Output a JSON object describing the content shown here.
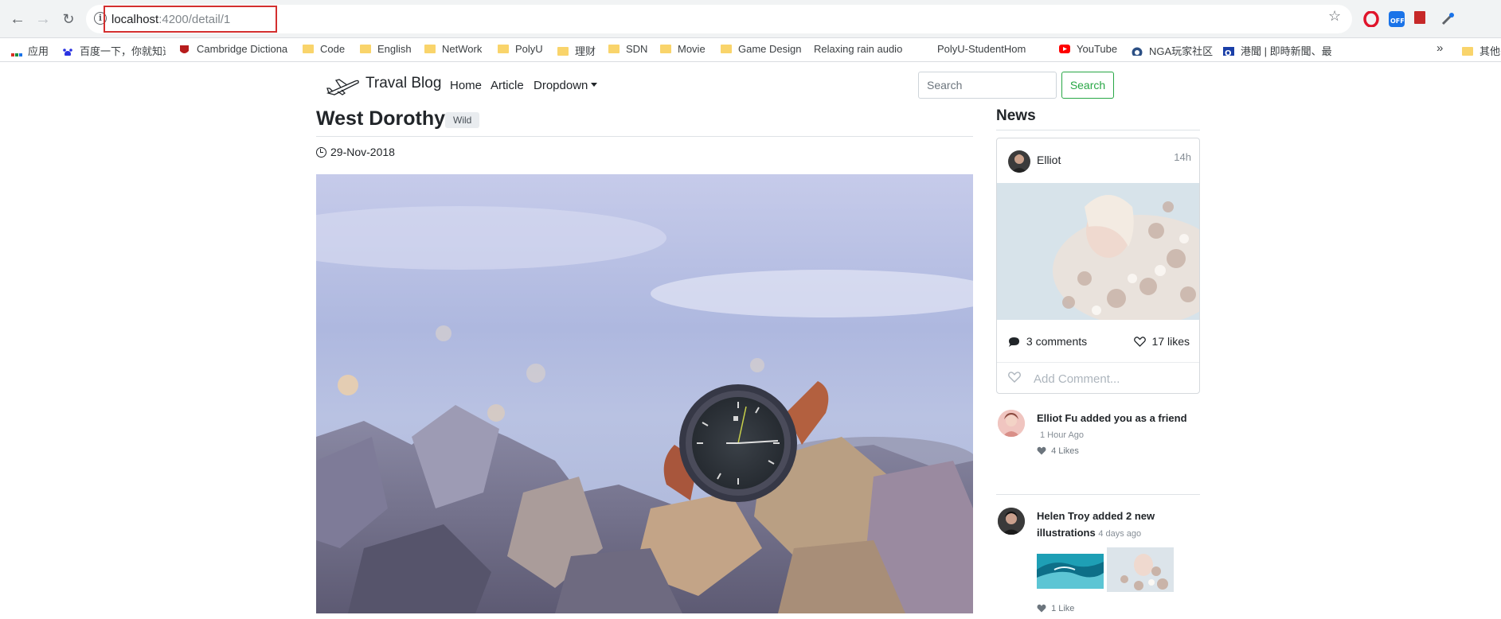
{
  "browser": {
    "url_host": "localhost",
    "url_port_path": ":4200/detail/1",
    "bookmarks": [
      {
        "label": "应用",
        "icon": "apps-grid-icon"
      },
      {
        "label": "百度一下，你就知道",
        "icon": "baidu-paw-icon"
      },
      {
        "label": "Cambridge Dictiona",
        "icon": "cambridge-shield-icon"
      },
      {
        "label": "Code",
        "icon": "folder-icon"
      },
      {
        "label": "English",
        "icon": "folder-icon"
      },
      {
        "label": "NetWork",
        "icon": "folder-icon"
      },
      {
        "label": "PolyU",
        "icon": "folder-icon"
      },
      {
        "label": "理财",
        "icon": "folder-icon"
      },
      {
        "label": "SDN",
        "icon": "folder-icon"
      },
      {
        "label": "Movie",
        "icon": "folder-icon"
      },
      {
        "label": "Game Design",
        "icon": "folder-icon"
      },
      {
        "label": "Relaxing rain audio",
        "icon": "page-icon"
      },
      {
        "label": "PolyU-StudentHom",
        "icon": "page-icon"
      },
      {
        "label": "YouTube",
        "icon": "youtube-icon"
      },
      {
        "label": "NGA玩家社区",
        "icon": "nga-icon"
      },
      {
        "label": "港聞 | 即時新聞、最",
        "icon": "news-icon"
      },
      {
        "label": "»",
        "icon": ""
      },
      {
        "label": "其他书",
        "icon": "folder-icon"
      }
    ]
  },
  "navbar": {
    "brand": "Traval Blog",
    "links": [
      "Home",
      "Article",
      "Dropdown"
    ],
    "search_placeholder": "Search",
    "search_button": "Search"
  },
  "post": {
    "title": "West Dorothy",
    "tag": "Wild",
    "date": "29-Nov-2018"
  },
  "sidebar": {
    "title": "News",
    "card": {
      "author": "Elliot",
      "time": "14h",
      "comments": "3 comments",
      "likes": "17 likes",
      "add_comment_placeholder": "Add Comment..."
    },
    "feed": [
      {
        "text": "Elliot Fu added you as a friend",
        "meta": "1 Hour Ago",
        "likes": "4 Likes"
      },
      {
        "text_line1": "Helen Troy added 2 new",
        "text_line2": "illustrations",
        "meta": "4 days ago",
        "likes": "1 Like"
      }
    ]
  },
  "colors": {
    "accent_green": "#28a745",
    "highlight_red": "#d32f2f"
  }
}
